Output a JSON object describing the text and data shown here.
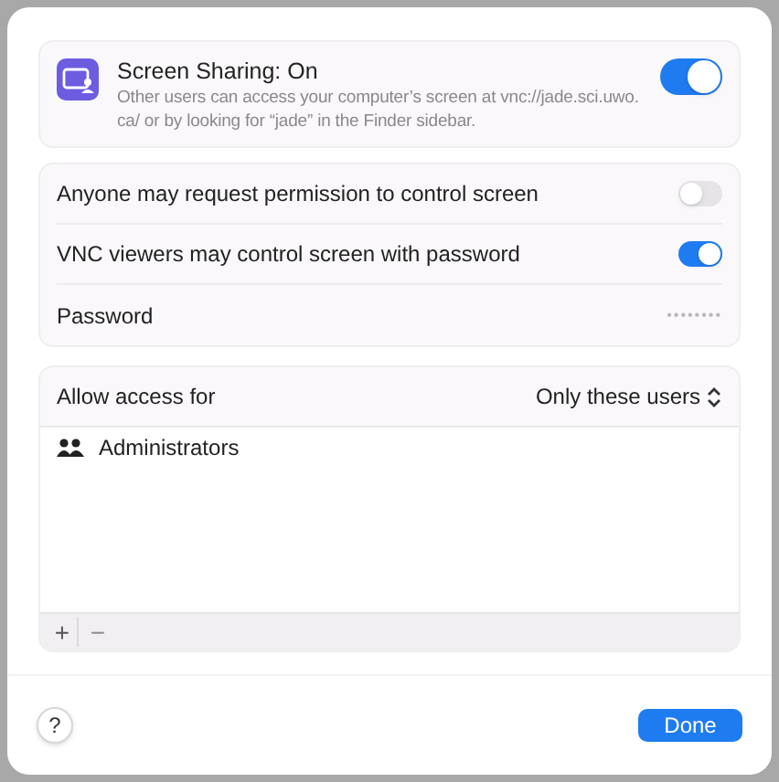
{
  "sharing": {
    "title": "Screen Sharing: On",
    "description": "Other users can access your computer’s screen at vnc://jade.sci.uwo.ca/ or by looking for “jade” in the Finder sidebar.",
    "on": true
  },
  "options": [
    {
      "label": "Anyone may request permission to control screen",
      "on": false
    },
    {
      "label": "VNC viewers may control screen with password",
      "on": true
    }
  ],
  "password": {
    "label": "Password",
    "value": "••••••••"
  },
  "access": {
    "label": "Allow access for",
    "value": "Only these users",
    "users": [
      {
        "name": "Administrators"
      }
    ],
    "add": "+",
    "remove": "−",
    "remove_disabled": true
  },
  "help": "?",
  "done": "Done"
}
